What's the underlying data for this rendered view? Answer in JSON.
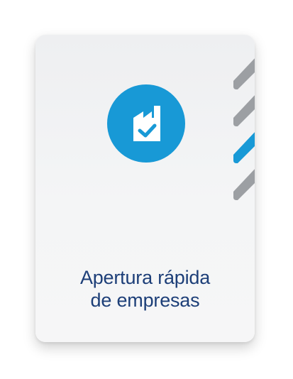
{
  "card": {
    "title_line1": "Apertura rápida",
    "title_line2": "de empresas",
    "icon": "factory-check-icon",
    "tabs": [
      {
        "name": "tab-1",
        "color": "#9c9fa3"
      },
      {
        "name": "tab-2",
        "color": "#9c9fa3"
      },
      {
        "name": "tab-3",
        "color": "#1899d6"
      },
      {
        "name": "tab-4",
        "color": "#9c9fa3"
      }
    ]
  },
  "colors": {
    "accent": "#1899d6",
    "title": "#1d3f78",
    "tab_gray": "#9c9fa3"
  }
}
